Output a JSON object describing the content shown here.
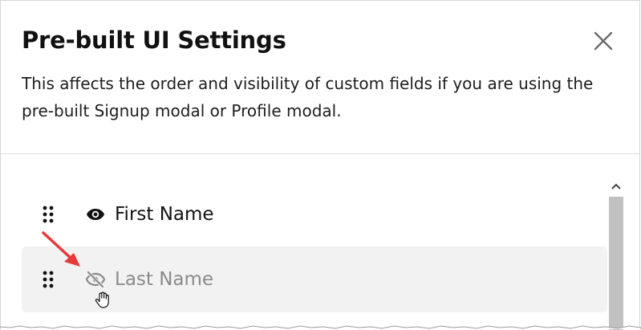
{
  "modal": {
    "title": "Pre-built UI Settings",
    "description": "This affects the order and visibility of custom fields if you are using the pre-built Signup modal or Profile modal.",
    "close_icon": "close-icon"
  },
  "fields": [
    {
      "label": "First Name",
      "visible": true,
      "icon": "eye-icon"
    },
    {
      "label": "Last Name",
      "visible": false,
      "icon": "eye-off-icon"
    }
  ],
  "colors": {
    "annotation_arrow": "#e8393b",
    "hidden_text": "#8a8a8a",
    "selected_row_bg": "#f2f2f2"
  }
}
